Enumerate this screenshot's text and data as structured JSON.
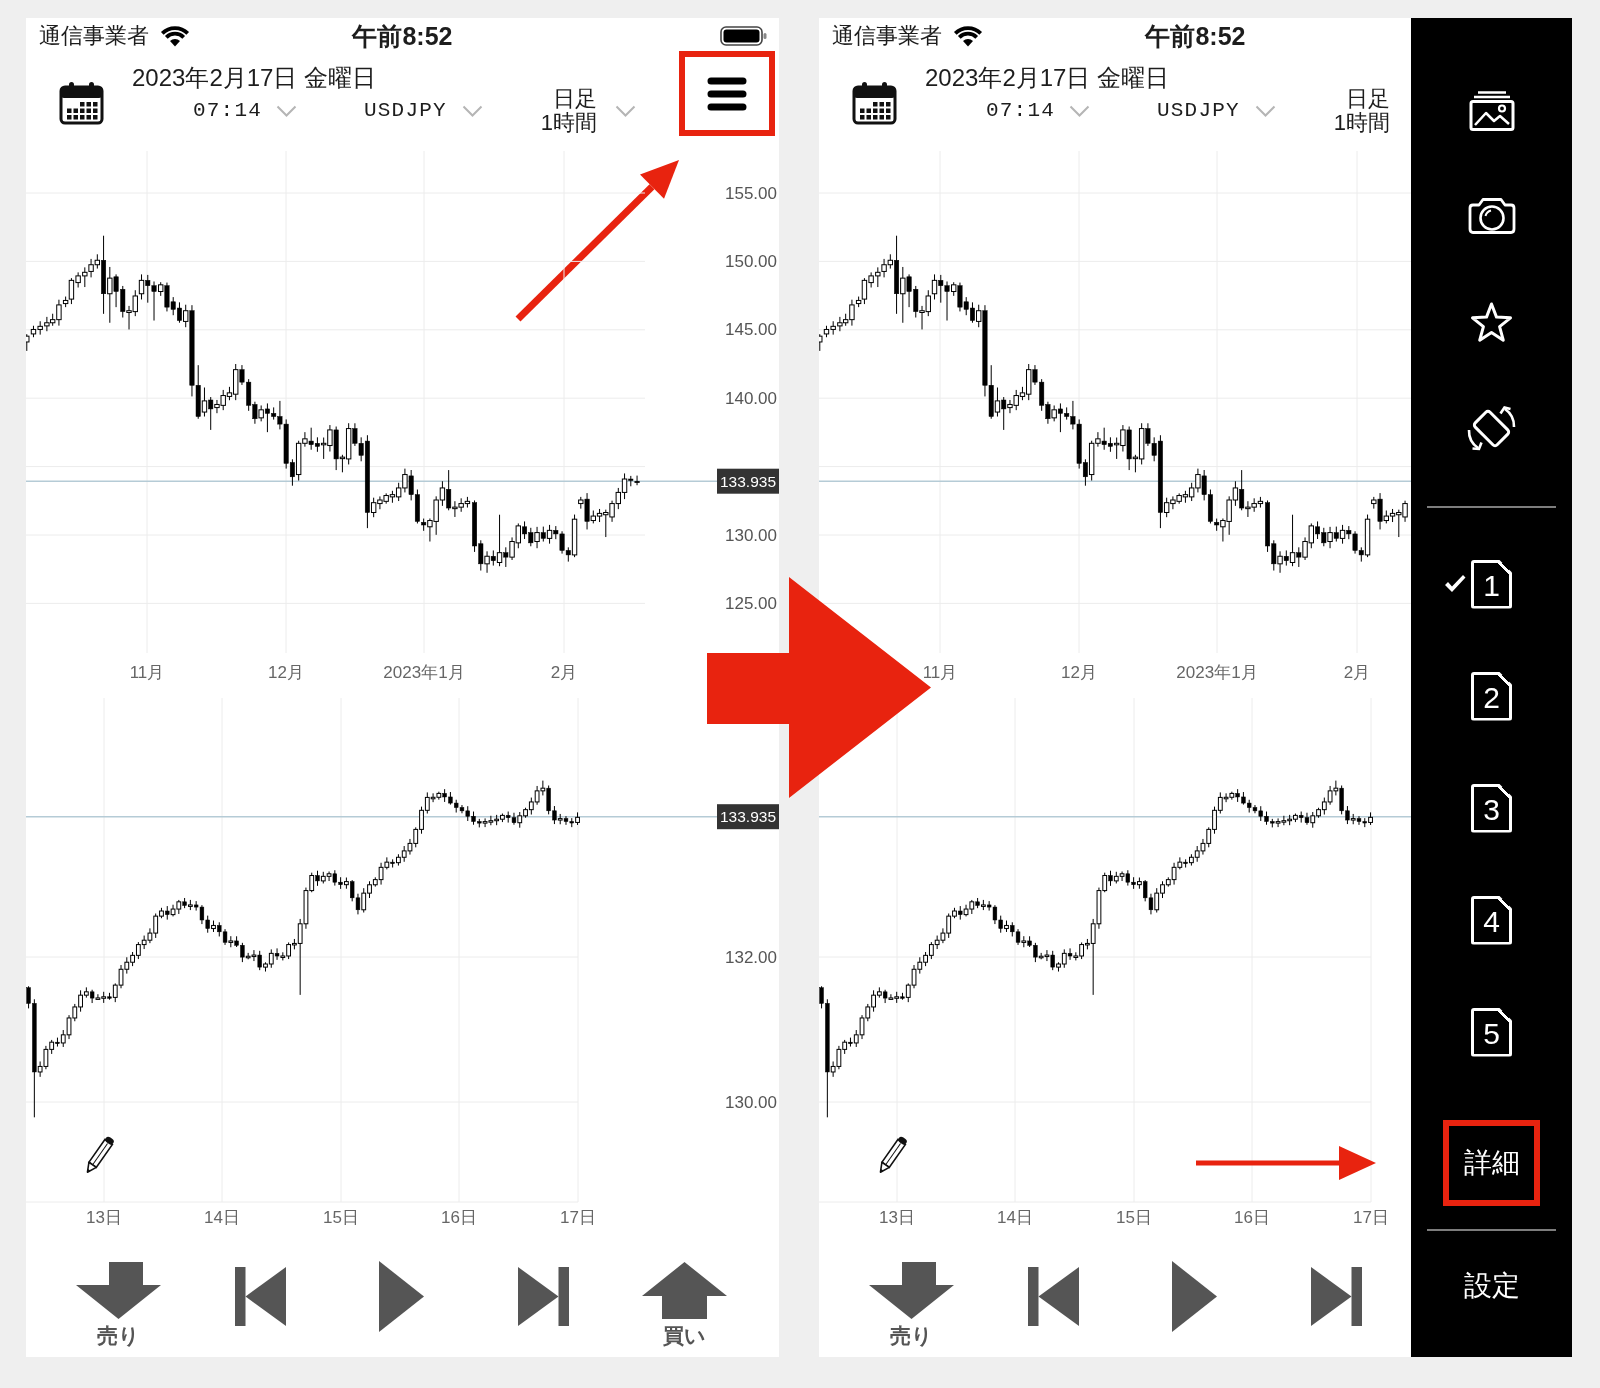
{
  "screens": [
    {
      "status_bar": {
        "carrier": "通信事業者",
        "time": "午前8:52"
      },
      "header": {
        "date": "2023年2月17日 金曜日",
        "time": "07:14",
        "symbol": "USDJPY",
        "timeframes": [
          "日足",
          "1時間"
        ],
        "menu_highlighted": true
      },
      "charts": [
        {
          "y_labels": [
            "155.00",
            "150.00",
            "145.00",
            "140.00",
            "130.00",
            "125.00"
          ],
          "price_tag": "133.935",
          "x_labels": [
            "11月",
            "12月",
            "2023年1月",
            "2月"
          ]
        },
        {
          "y_labels": [
            "132.00",
            "130.00"
          ],
          "price_tag": "133.935",
          "x_labels": [
            "13日",
            "14日",
            "15日",
            "16日",
            "17日"
          ]
        }
      ],
      "toolbar": [
        {
          "kind": "sell",
          "label": "売り"
        },
        {
          "kind": "back"
        },
        {
          "kind": "play"
        },
        {
          "kind": "forward"
        },
        {
          "kind": "buy",
          "label": "買い"
        }
      ]
    },
    {
      "status_bar": {
        "carrier": "通信事業者",
        "time": "午前8:52"
      },
      "header": {
        "date": "2023年2月17日 金曜日",
        "time": "07:14",
        "symbol": "USDJPY",
        "timeframes": [
          "日足",
          "1時間"
        ]
      },
      "charts": [
        {
          "x_labels": [
            "11月",
            "12月",
            "2023年1月",
            "2月"
          ]
        },
        {
          "x_labels": [
            "13日",
            "14日",
            "15日",
            "16日",
            "17日"
          ]
        }
      ],
      "toolbar": [
        {
          "kind": "sell",
          "label": "売り"
        },
        {
          "kind": "back"
        },
        {
          "kind": "play"
        },
        {
          "kind": "forward"
        }
      ],
      "side_menu": {
        "layouts": [
          {
            "label": "1",
            "selected": true
          },
          {
            "label": "2",
            "selected": false
          },
          {
            "label": "3",
            "selected": false
          },
          {
            "label": "4",
            "selected": false
          },
          {
            "label": "5",
            "selected": false
          }
        ],
        "items": [
          {
            "label": "詳細",
            "highlighted": true
          },
          {
            "label": "設定",
            "highlighted": false
          }
        ]
      }
    }
  ]
}
